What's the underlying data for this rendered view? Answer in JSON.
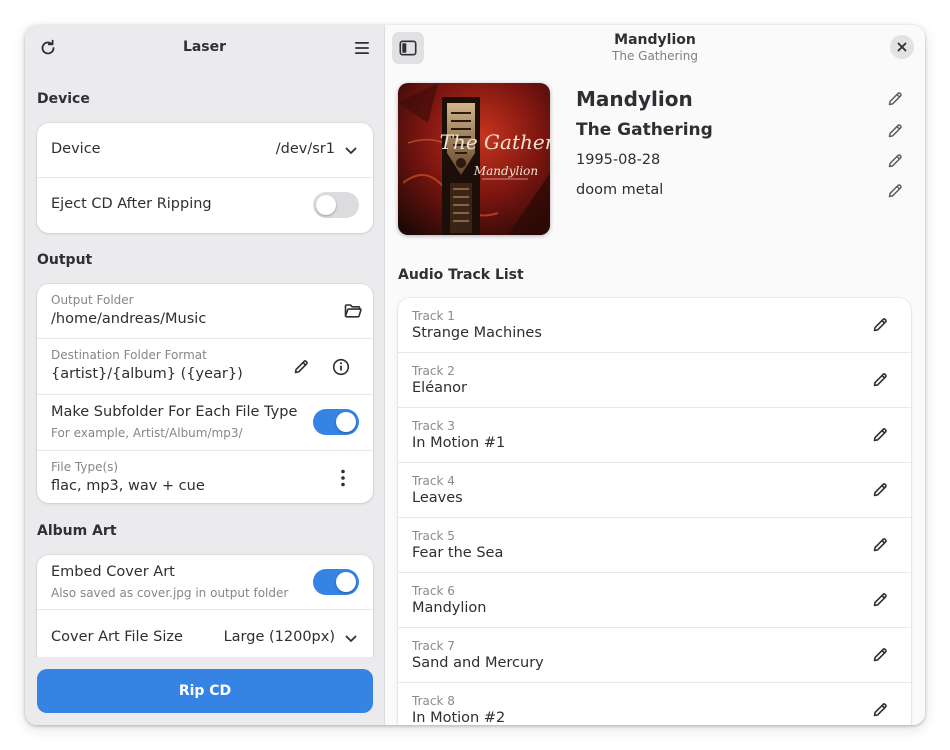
{
  "sidebar": {
    "title": "Laser",
    "device_section": {
      "heading": "Device",
      "device_label": "Device",
      "device_value": "/dev/sr1",
      "eject_label": "Eject CD After Ripping",
      "eject_enabled": false
    },
    "output_section": {
      "heading": "Output",
      "folder_label": "Output Folder",
      "folder_value": "/home/andreas/Music",
      "format_label": "Destination Folder Format",
      "format_value": "{artist}/{album} ({year})",
      "subfolder_label": "Make Subfolder For Each File Type",
      "subfolder_hint": "For example, Artist/Album/mp3/",
      "subfolder_enabled": true,
      "filetypes_label": "File Type(s)",
      "filetypes_value": "flac, mp3, wav + cue"
    },
    "album_art_section": {
      "heading": "Album Art",
      "embed_label": "Embed Cover Art",
      "embed_hint": "Also saved as cover.jpg in output folder",
      "embed_enabled": true,
      "size_label": "Cover Art File Size",
      "size_value": "Large (1200px)"
    },
    "rip_button": "Rip CD"
  },
  "header": {
    "title": "Mandylion",
    "subtitle": "The Gathering"
  },
  "album": {
    "title": "Mandylion",
    "artist": "The Gathering",
    "date": "1995-08-28",
    "genre": "doom metal",
    "cover_text_band": "The Gathering",
    "cover_text_album": "Mandylion"
  },
  "track_list": {
    "heading": "Audio Track List",
    "tracks": [
      {
        "number": "Track 1",
        "title": "Strange Machines"
      },
      {
        "number": "Track 2",
        "title": "Eléanor"
      },
      {
        "number": "Track 3",
        "title": "In Motion #1"
      },
      {
        "number": "Track 4",
        "title": "Leaves"
      },
      {
        "number": "Track 5",
        "title": "Fear the Sea"
      },
      {
        "number": "Track 6",
        "title": "Mandylion"
      },
      {
        "number": "Track 7",
        "title": "Sand and Mercury"
      },
      {
        "number": "Track 8",
        "title": "In Motion #2"
      }
    ]
  },
  "colors": {
    "accent": "#3584e4",
    "sidebar_bg": "#ebebed",
    "content_bg": "#fafafb"
  }
}
